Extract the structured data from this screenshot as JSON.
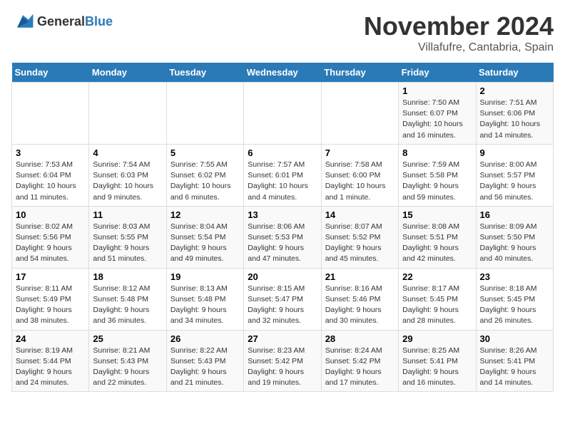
{
  "header": {
    "logo_general": "General",
    "logo_blue": "Blue",
    "month": "November 2024",
    "location": "Villafufre, Cantabria, Spain"
  },
  "days_of_week": [
    "Sunday",
    "Monday",
    "Tuesday",
    "Wednesday",
    "Thursday",
    "Friday",
    "Saturday"
  ],
  "weeks": [
    [
      {
        "day": "",
        "info": ""
      },
      {
        "day": "",
        "info": ""
      },
      {
        "day": "",
        "info": ""
      },
      {
        "day": "",
        "info": ""
      },
      {
        "day": "",
        "info": ""
      },
      {
        "day": "1",
        "info": "Sunrise: 7:50 AM\nSunset: 6:07 PM\nDaylight: 10 hours\nand 16 minutes."
      },
      {
        "day": "2",
        "info": "Sunrise: 7:51 AM\nSunset: 6:06 PM\nDaylight: 10 hours\nand 14 minutes."
      }
    ],
    [
      {
        "day": "3",
        "info": "Sunrise: 7:53 AM\nSunset: 6:04 PM\nDaylight: 10 hours\nand 11 minutes."
      },
      {
        "day": "4",
        "info": "Sunrise: 7:54 AM\nSunset: 6:03 PM\nDaylight: 10 hours\nand 9 minutes."
      },
      {
        "day": "5",
        "info": "Sunrise: 7:55 AM\nSunset: 6:02 PM\nDaylight: 10 hours\nand 6 minutes."
      },
      {
        "day": "6",
        "info": "Sunrise: 7:57 AM\nSunset: 6:01 PM\nDaylight: 10 hours\nand 4 minutes."
      },
      {
        "day": "7",
        "info": "Sunrise: 7:58 AM\nSunset: 6:00 PM\nDaylight: 10 hours\nand 1 minute."
      },
      {
        "day": "8",
        "info": "Sunrise: 7:59 AM\nSunset: 5:58 PM\nDaylight: 9 hours\nand 59 minutes."
      },
      {
        "day": "9",
        "info": "Sunrise: 8:00 AM\nSunset: 5:57 PM\nDaylight: 9 hours\nand 56 minutes."
      }
    ],
    [
      {
        "day": "10",
        "info": "Sunrise: 8:02 AM\nSunset: 5:56 PM\nDaylight: 9 hours\nand 54 minutes."
      },
      {
        "day": "11",
        "info": "Sunrise: 8:03 AM\nSunset: 5:55 PM\nDaylight: 9 hours\nand 51 minutes."
      },
      {
        "day": "12",
        "info": "Sunrise: 8:04 AM\nSunset: 5:54 PM\nDaylight: 9 hours\nand 49 minutes."
      },
      {
        "day": "13",
        "info": "Sunrise: 8:06 AM\nSunset: 5:53 PM\nDaylight: 9 hours\nand 47 minutes."
      },
      {
        "day": "14",
        "info": "Sunrise: 8:07 AM\nSunset: 5:52 PM\nDaylight: 9 hours\nand 45 minutes."
      },
      {
        "day": "15",
        "info": "Sunrise: 8:08 AM\nSunset: 5:51 PM\nDaylight: 9 hours\nand 42 minutes."
      },
      {
        "day": "16",
        "info": "Sunrise: 8:09 AM\nSunset: 5:50 PM\nDaylight: 9 hours\nand 40 minutes."
      }
    ],
    [
      {
        "day": "17",
        "info": "Sunrise: 8:11 AM\nSunset: 5:49 PM\nDaylight: 9 hours\nand 38 minutes."
      },
      {
        "day": "18",
        "info": "Sunrise: 8:12 AM\nSunset: 5:48 PM\nDaylight: 9 hours\nand 36 minutes."
      },
      {
        "day": "19",
        "info": "Sunrise: 8:13 AM\nSunset: 5:48 PM\nDaylight: 9 hours\nand 34 minutes."
      },
      {
        "day": "20",
        "info": "Sunrise: 8:15 AM\nSunset: 5:47 PM\nDaylight: 9 hours\nand 32 minutes."
      },
      {
        "day": "21",
        "info": "Sunrise: 8:16 AM\nSunset: 5:46 PM\nDaylight: 9 hours\nand 30 minutes."
      },
      {
        "day": "22",
        "info": "Sunrise: 8:17 AM\nSunset: 5:45 PM\nDaylight: 9 hours\nand 28 minutes."
      },
      {
        "day": "23",
        "info": "Sunrise: 8:18 AM\nSunset: 5:45 PM\nDaylight: 9 hours\nand 26 minutes."
      }
    ],
    [
      {
        "day": "24",
        "info": "Sunrise: 8:19 AM\nSunset: 5:44 PM\nDaylight: 9 hours\nand 24 minutes."
      },
      {
        "day": "25",
        "info": "Sunrise: 8:21 AM\nSunset: 5:43 PM\nDaylight: 9 hours\nand 22 minutes."
      },
      {
        "day": "26",
        "info": "Sunrise: 8:22 AM\nSunset: 5:43 PM\nDaylight: 9 hours\nand 21 minutes."
      },
      {
        "day": "27",
        "info": "Sunrise: 8:23 AM\nSunset: 5:42 PM\nDaylight: 9 hours\nand 19 minutes."
      },
      {
        "day": "28",
        "info": "Sunrise: 8:24 AM\nSunset: 5:42 PM\nDaylight: 9 hours\nand 17 minutes."
      },
      {
        "day": "29",
        "info": "Sunrise: 8:25 AM\nSunset: 5:41 PM\nDaylight: 9 hours\nand 16 minutes."
      },
      {
        "day": "30",
        "info": "Sunrise: 8:26 AM\nSunset: 5:41 PM\nDaylight: 9 hours\nand 14 minutes."
      }
    ]
  ]
}
